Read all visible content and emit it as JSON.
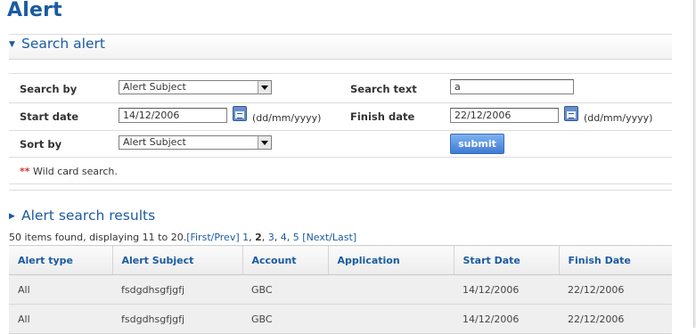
{
  "page_title": "Alert",
  "search_section": {
    "title": "Search alert",
    "search_by_label": "Search by",
    "search_by_value": "Alert Subject",
    "search_text_label": "Search text",
    "search_text_value": "a",
    "start_date_label": "Start date",
    "start_date_value": "14/12/2006",
    "date_format_hint": "(dd/mm/yyyy)",
    "finish_date_label": "Finish date",
    "finish_date_value": "22/12/2006",
    "sort_by_label": "Sort by",
    "sort_by_value": "Alert Subject",
    "submit_label": "submit",
    "note_stars": "**",
    "note_text": "Wild card search."
  },
  "results_section": {
    "title": "Alert search results",
    "summary": "50 items found, displaying 11 to 20.",
    "first_prev": "[First/Prev]",
    "pages": [
      "1",
      "2",
      "3",
      "4",
      "5"
    ],
    "current_page": "2",
    "next_last": "[Next/Last]",
    "columns": [
      "Alert type",
      "Alert Subject",
      "Account",
      "Application",
      "Start Date",
      "Finish Date"
    ],
    "rows": [
      [
        "All",
        "fsdgdhsgfjgfj",
        "GBC",
        "",
        "14/12/2006",
        "22/12/2006"
      ],
      [
        "All",
        "fsdgdhsgfjgfj",
        "GBC",
        "",
        "14/12/2006",
        "22/12/2006"
      ]
    ]
  },
  "icons": {
    "calendar": "calendar-icon",
    "collapse": "triangle-down-icon",
    "expand": "triangle-right-icon"
  },
  "colors": {
    "heading_blue": "#1a5b9f",
    "button_blue": "#3f7bd4",
    "row_grey": "#efefef"
  }
}
